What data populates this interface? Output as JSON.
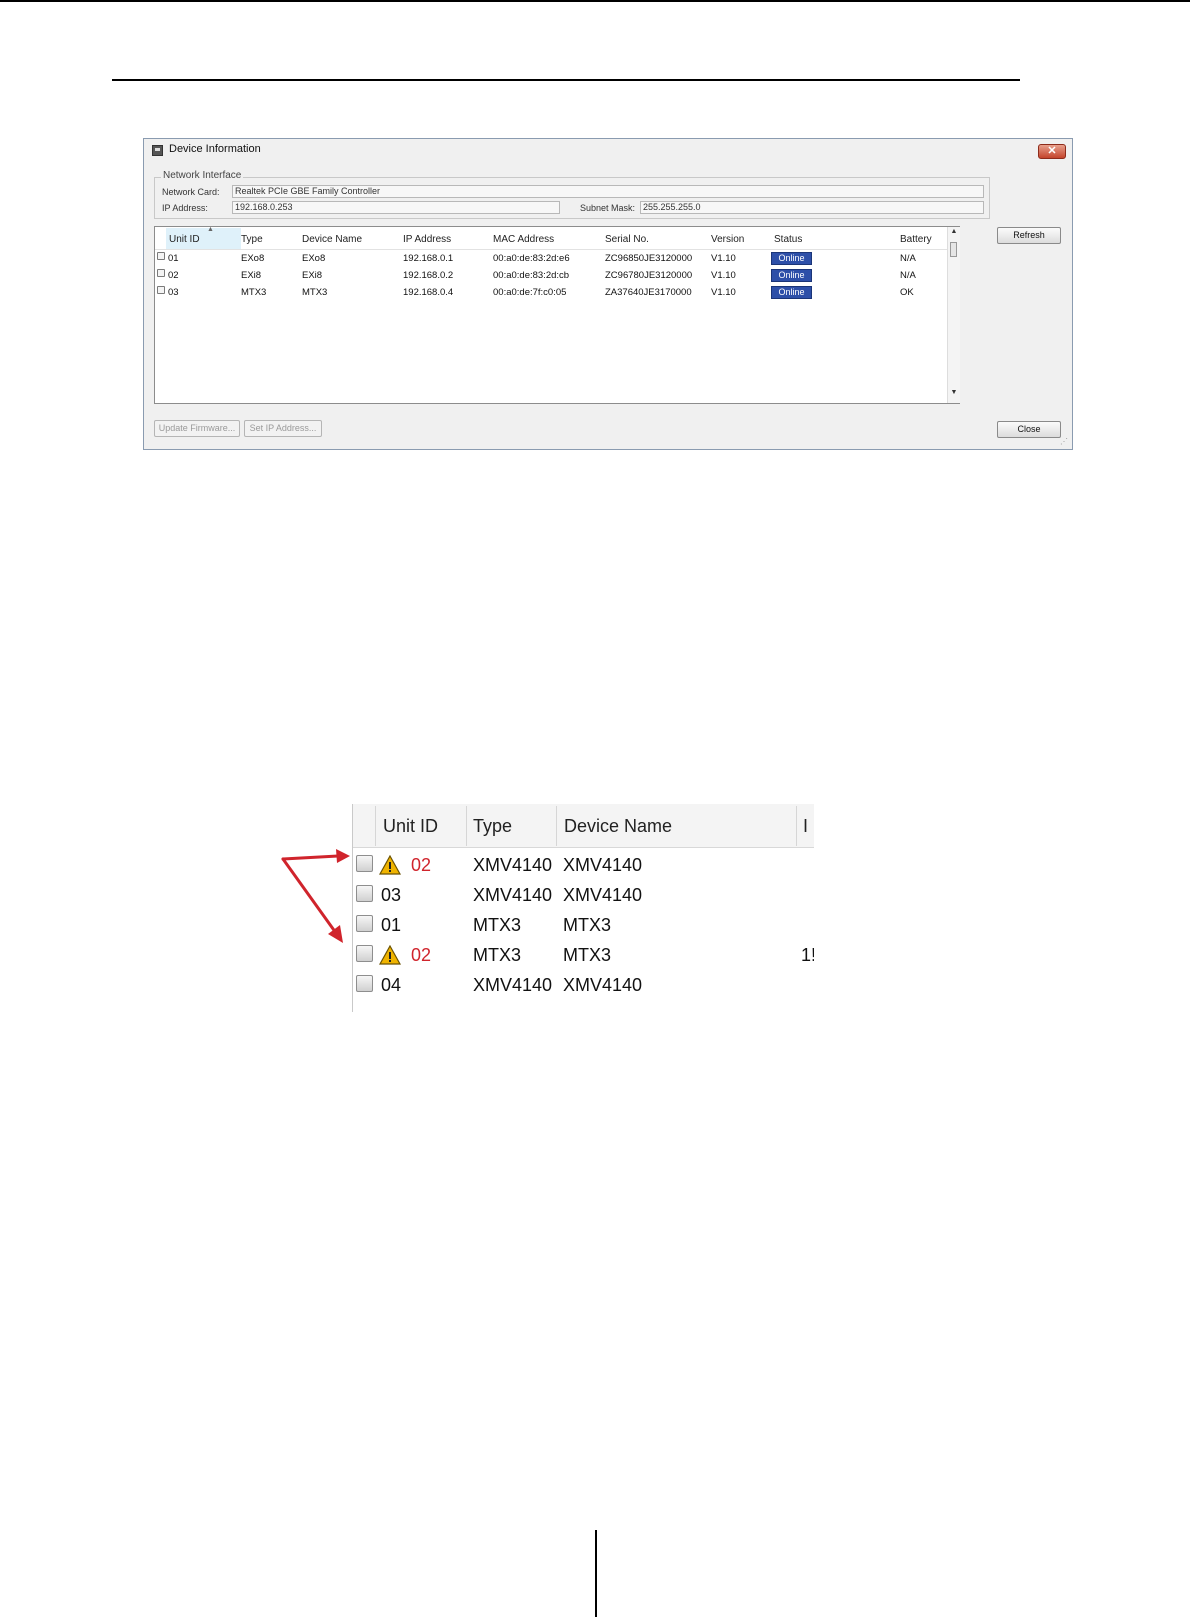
{
  "window": {
    "title": "Device Information",
    "close_glyph": "✕",
    "network_interface": {
      "legend": "Network Interface",
      "network_card_label": "Network Card:",
      "network_card_value": "Realtek PCIe GBE Family Controller",
      "ip_label": "IP Address:",
      "ip_value": "192.168.0.253",
      "subnet_label": "Subnet Mask:",
      "subnet_value": "255.255.255.0"
    },
    "table": {
      "columns": [
        "Unit ID",
        "Type",
        "Device Name",
        "IP Address",
        "MAC Address",
        "Serial No.",
        "Version",
        "Status",
        "Battery"
      ],
      "rows": [
        {
          "unit_id": "01",
          "type": "EXo8",
          "device_name": "EXo8",
          "ip": "192.168.0.1",
          "mac": "00:a0:de:83:2d:e6",
          "serial": "ZC96850JE3120000",
          "version": "V1.10",
          "status": "Online",
          "battery": "N/A"
        },
        {
          "unit_id": "02",
          "type": "EXi8",
          "device_name": "EXi8",
          "ip": "192.168.0.2",
          "mac": "00:a0:de:83:2d:cb",
          "serial": "ZC96780JE3120000",
          "version": "V1.10",
          "status": "Online",
          "battery": "N/A"
        },
        {
          "unit_id": "03",
          "type": "MTX3",
          "device_name": "MTX3",
          "ip": "192.168.0.4",
          "mac": "00:a0:de:7f:c0:05",
          "serial": "ZA37640JE3170000",
          "version": "V1.10",
          "status": "Online",
          "battery": "OK"
        }
      ]
    },
    "buttons": {
      "refresh": "Refresh",
      "update_firmware": "Update Firmware...",
      "set_ip_address": "Set IP Address...",
      "close": "Close"
    },
    "colors": {
      "online_badge": "#2d4fa8",
      "close_button": "#c4442c"
    }
  },
  "zoom_list": {
    "columns": [
      "Unit ID",
      "Type",
      "Device Name",
      "I"
    ],
    "rows": [
      {
        "unit_id": "02",
        "type": "XMV4140",
        "device_name": "XMV4140",
        "ip": "",
        "warning": true
      },
      {
        "unit_id": "03",
        "type": "XMV4140",
        "device_name": "XMV4140",
        "ip": "",
        "warning": false
      },
      {
        "unit_id": "01",
        "type": "MTX3",
        "device_name": "MTX3",
        "ip": "",
        "warning": false
      },
      {
        "unit_id": "02",
        "type": "MTX3",
        "device_name": "MTX3",
        "ip": "1!",
        "warning": true
      },
      {
        "unit_id": "04",
        "type": "XMV4140",
        "device_name": "XMV4140",
        "ip": "",
        "warning": false
      }
    ],
    "colors": {
      "duplicate_id": "#d0242c",
      "arrow": "#d0242c",
      "warning_icon": "#f0b400"
    }
  }
}
